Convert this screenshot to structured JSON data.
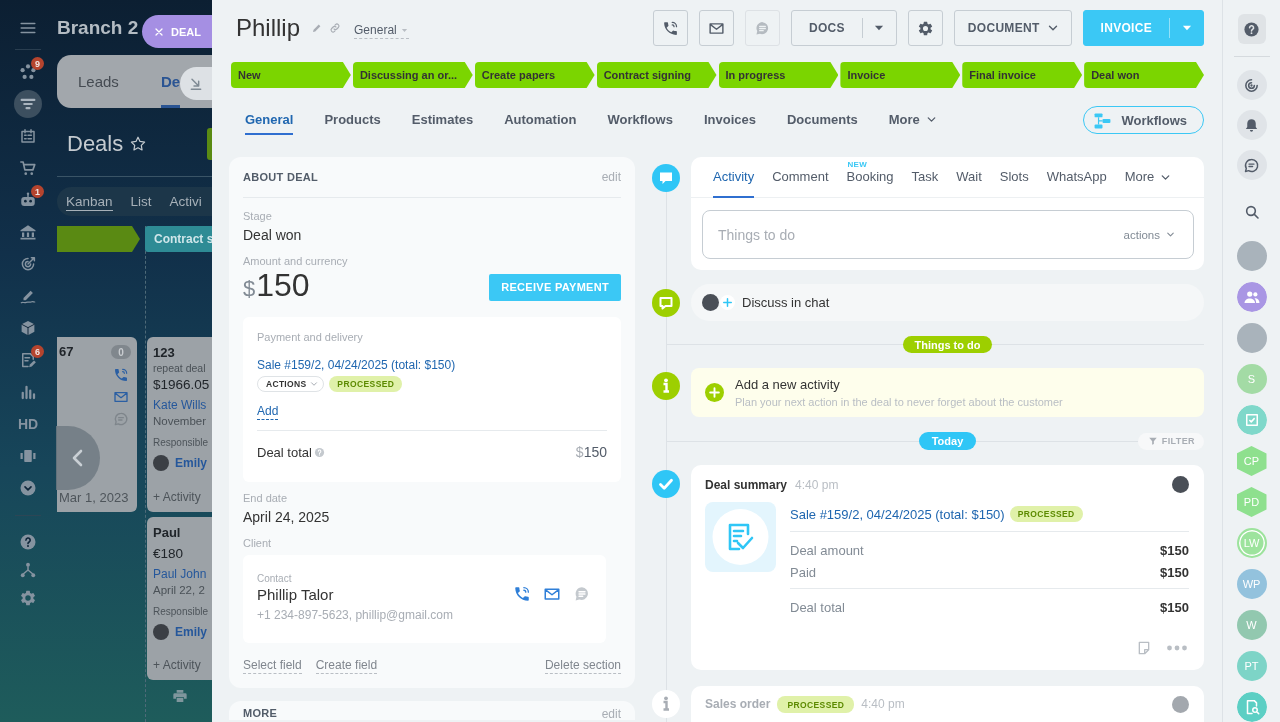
{
  "background": {
    "nav": {
      "items": [
        {
          "selected": false
        },
        {
          "badge": "9",
          "selected": false
        },
        {
          "selected": true
        },
        {
          "selected": false
        },
        {
          "selected": false
        },
        {
          "badge": "1",
          "selected": false
        },
        {
          "selected": false
        },
        {
          "selected": false
        },
        {
          "selected": false
        },
        {
          "selected": false
        },
        {
          "badge": "6",
          "selected": false
        },
        {
          "selected": false
        },
        {
          "label": "HD",
          "selected": false
        },
        {
          "selected": false
        },
        {
          "selected": false
        }
      ],
      "bottom": [
        {
          "selected": false
        },
        {
          "selected": false
        },
        {
          "selected": false
        }
      ]
    },
    "title": "Branch 2",
    "tabs": [
      {
        "label": "Leads",
        "selected": false
      },
      {
        "label": "De",
        "selected": true
      }
    ],
    "heading": "Deals",
    "views": [
      {
        "label": "Kanban",
        "selected": true
      },
      {
        "label": "List",
        "selected": false
      },
      {
        "label": "Activi",
        "selected": false
      }
    ],
    "columns": [
      {
        "color": "#5a8a13",
        "cards": [
          {
            "kind": "compact",
            "title": "67",
            "counter": "0",
            "date": "Mar 1, 2023"
          }
        ]
      },
      {
        "label": "Contract s",
        "color": "#2e8b95",
        "cards": [
          {
            "kind": "full",
            "title": "123",
            "subtitle": "repeat deal",
            "amount": "$1966.05",
            "contact": "Kate Wills",
            "date": "November",
            "responsible_label": "Responsible",
            "responsible": "Emily",
            "activity": "+ Activity"
          },
          {
            "kind": "full",
            "title": "Paul",
            "amount": "€180",
            "contact": "Paul John",
            "date": "April 22, 2",
            "responsible_label": "Responsible",
            "responsible": "Emily",
            "activity": "+ Activity"
          }
        ]
      }
    ],
    "deal_tab": "DEAL"
  },
  "deal": {
    "title": "Phillip",
    "category": "General",
    "toolbar": [
      {
        "kind": "icon",
        "disabled": false,
        "primary": false
      },
      {
        "kind": "icon",
        "disabled": false,
        "primary": false
      },
      {
        "kind": "icon",
        "disabled": true,
        "primary": false
      },
      {
        "kind": "split",
        "label": "DOCS",
        "disabled": false,
        "primary": false
      },
      {
        "kind": "icon",
        "disabled": false,
        "primary": false
      },
      {
        "kind": "dropdown",
        "label": "DOCUMENT",
        "disabled": false,
        "primary": false
      },
      {
        "kind": "split",
        "label": "INVOICE",
        "disabled": false,
        "primary": true
      }
    ],
    "stages": [
      {
        "label": "New",
        "done": true
      },
      {
        "label": "Discussing an or...",
        "done": true
      },
      {
        "label": "Create papers",
        "done": true
      },
      {
        "label": "Contract signing",
        "done": true
      },
      {
        "label": "In progress",
        "done": true
      },
      {
        "label": "Invoice",
        "done": true
      },
      {
        "label": "Final invoice",
        "done": true
      },
      {
        "label": "Deal won",
        "done": true
      }
    ],
    "tabs": [
      {
        "label": "General",
        "selected": true
      },
      {
        "label": "Products",
        "selected": false
      },
      {
        "label": "Estimates",
        "selected": false
      },
      {
        "label": "Automation",
        "selected": false
      },
      {
        "label": "Workflows",
        "selected": false
      },
      {
        "label": "Invoices",
        "selected": false
      },
      {
        "label": "Documents",
        "selected": false
      }
    ],
    "more_tab": "More",
    "workflows_button": "Workflows"
  },
  "about": {
    "title": "ABOUT DEAL",
    "edit": "edit",
    "stage_label": "Stage",
    "stage": "Deal won",
    "amount_label": "Amount and currency",
    "currency": "$",
    "amount": "150",
    "pay_button": "RECEIVE PAYMENT",
    "payment": {
      "title": "Payment and delivery",
      "sale": "Sale #159/2, 04/24/2025 (total: $150)",
      "actions": "ACTIONS",
      "status": "PROCESSED",
      "add": "Add",
      "total_label": "Deal total",
      "total_currency": "$",
      "total": "150"
    },
    "end_date_label": "End date",
    "end_date": "April 24, 2025",
    "client_label": "Client",
    "contact": {
      "role": "Contact",
      "name": "Phillip Talor",
      "details": "+1 234-897-5623, phillip@gmail.com",
      "channels": [
        {
          "disabled": false
        },
        {
          "disabled": false
        },
        {
          "disabled": true
        }
      ]
    },
    "links": [
      "Select field",
      "Create field"
    ],
    "delete": "Delete section"
  },
  "more_section": {
    "title": "MORE",
    "edit": "edit"
  },
  "timeline": {
    "composer": {
      "tabs": [
        {
          "label": "Activity",
          "selected": true
        },
        {
          "label": "Comment",
          "selected": false
        },
        {
          "label": "Booking",
          "selected": false,
          "badge": "NEW"
        },
        {
          "label": "Task",
          "selected": false
        },
        {
          "label": "Wait",
          "selected": false
        },
        {
          "label": "Slots",
          "selected": false
        },
        {
          "label": "WhatsApp",
          "selected": false
        }
      ],
      "more": "More",
      "placeholder": "Things to do",
      "actions": "actions"
    },
    "chat": "Discuss in chat",
    "todo_label": "Things to do",
    "add_activity": {
      "title": "Add a new activity",
      "hint": "Plan your next action in the deal to never forget about the customer"
    },
    "today_label": "Today",
    "filter": "FILTER",
    "summary": {
      "title": "Deal summary",
      "time": "4:40 pm",
      "sale": "Sale #159/2, 04/24/2025 (total: $150)",
      "status": "PROCESSED",
      "rows": [
        {
          "label": "Deal amount",
          "value": "$150"
        },
        {
          "label": "Paid",
          "value": "$150"
        },
        {
          "label": "Deal total",
          "value": "$150"
        }
      ]
    },
    "sales_order": {
      "title": "Sales order",
      "status": "PROCESSED",
      "time": "4:40 pm"
    }
  },
  "rail": {
    "contacts": [
      {
        "kind": "photo"
      },
      {
        "kind": "group",
        "color": "#a996e4"
      },
      {
        "kind": "photo"
      },
      {
        "kind": "initials",
        "label": "S",
        "color": "#a3dba5"
      },
      {
        "kind": "tasks",
        "color": "#7fd8ca"
      },
      {
        "kind": "hexagon",
        "label": "CP",
        "color": "#8ee08e"
      },
      {
        "kind": "hexagon",
        "label": "PD",
        "color": "#8ee08e"
      },
      {
        "kind": "ring",
        "label": "LW",
        "color": "#9de39d"
      },
      {
        "kind": "initials",
        "label": "WP",
        "color": "#93c2dd"
      },
      {
        "kind": "initials",
        "label": "W",
        "color": "#92c8af"
      },
      {
        "kind": "initials",
        "label": "PT",
        "color": "#7dd4c7"
      },
      {
        "kind": "finder",
        "color": "#5ccfc4"
      }
    ]
  }
}
